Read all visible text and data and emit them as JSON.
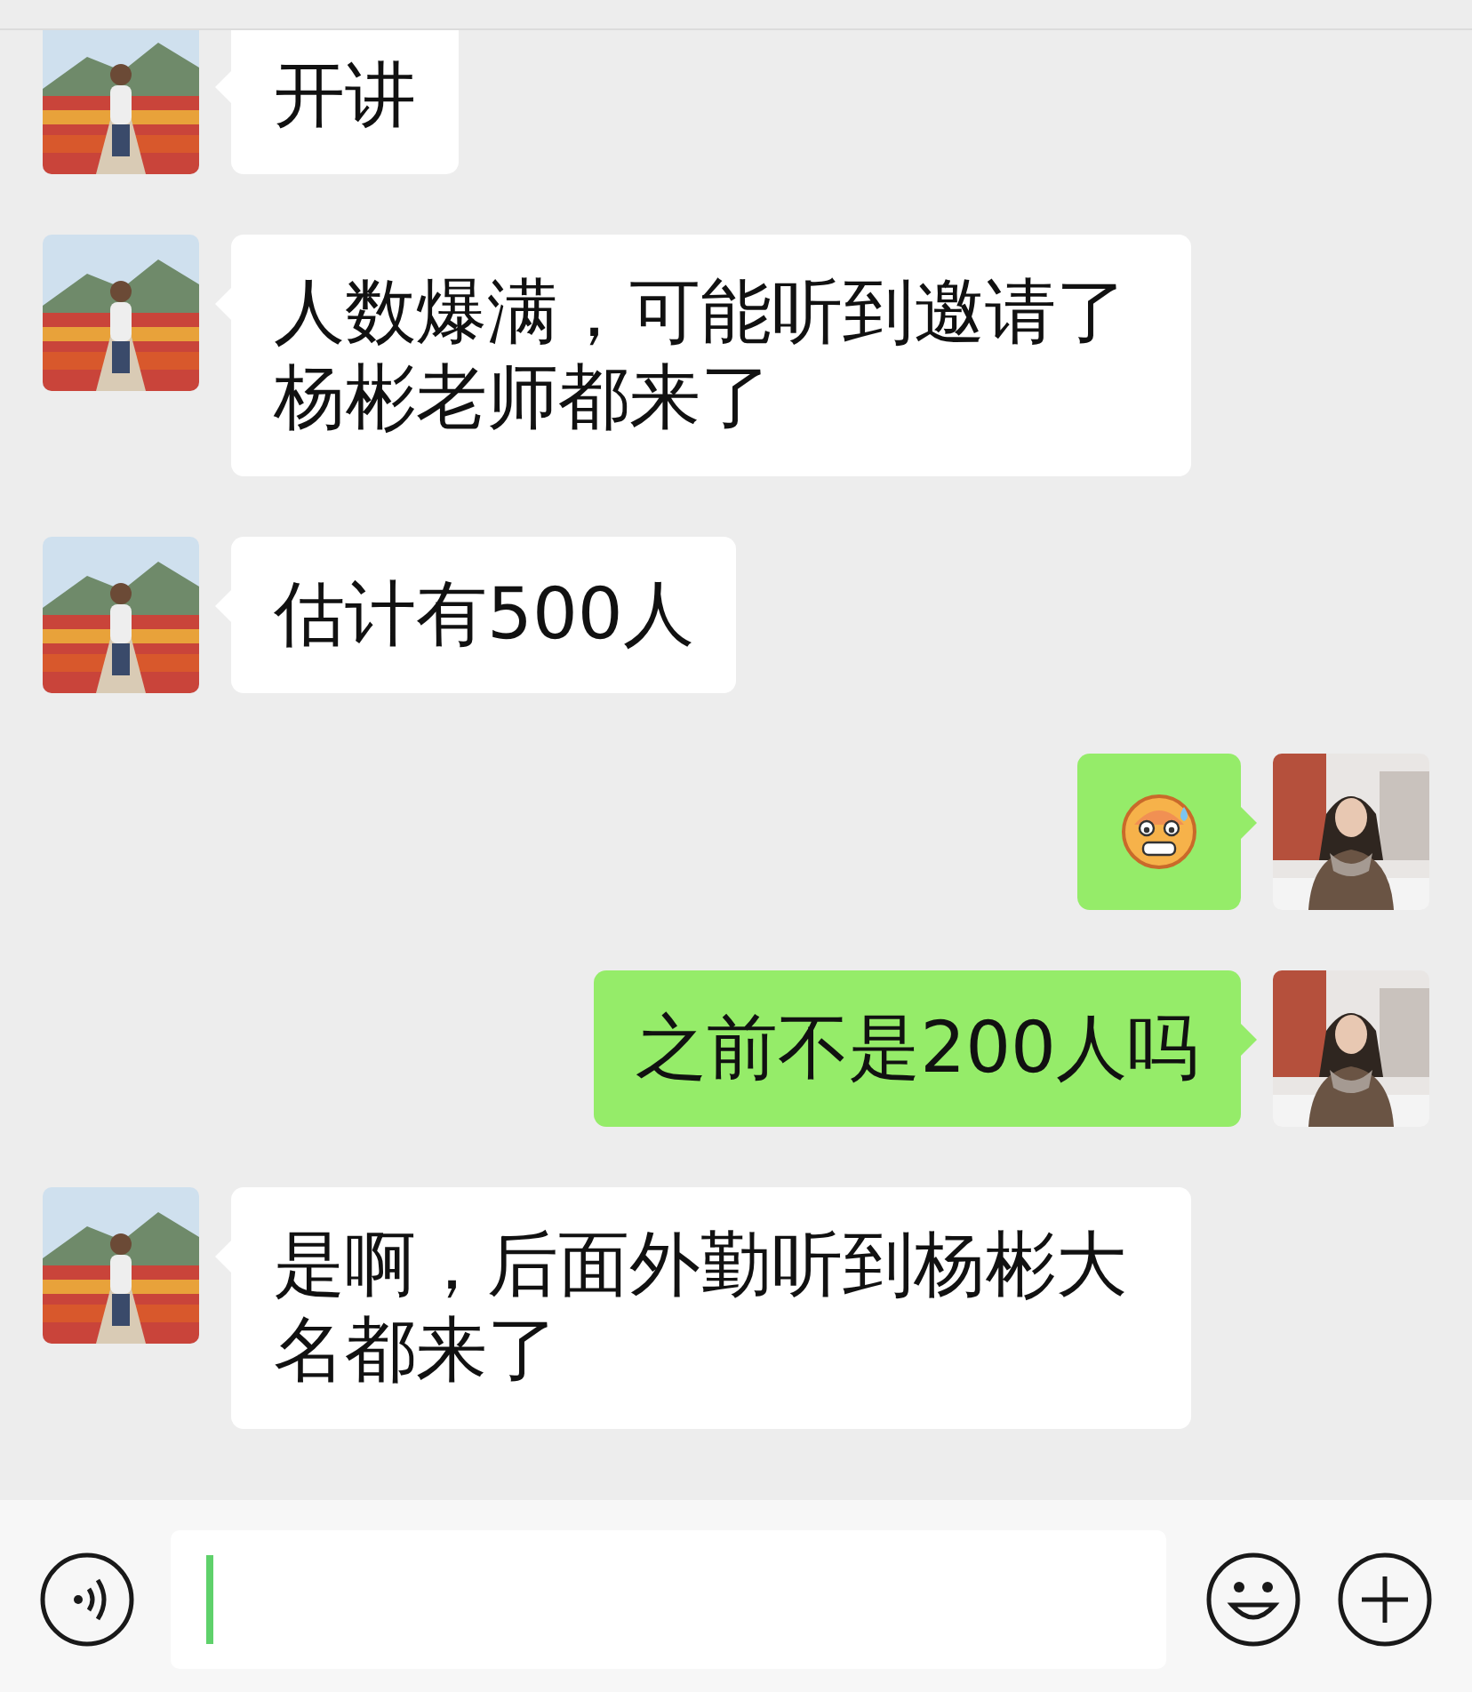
{
  "messages": [
    {
      "kind": "incoming_text",
      "text": "开讲"
    },
    {
      "kind": "incoming_text",
      "text": "人数爆满，可能听到邀请了杨彬老师都来了"
    },
    {
      "kind": "incoming_text",
      "text": "估计有500人"
    },
    {
      "kind": "outgoing_emoji"
    },
    {
      "kind": "outgoing_text",
      "text": "之前不是200人吗"
    },
    {
      "kind": "incoming_text",
      "text": "是啊，后面外勤听到杨彬大名都来了"
    }
  ],
  "input_bar": {
    "focused": true
  }
}
